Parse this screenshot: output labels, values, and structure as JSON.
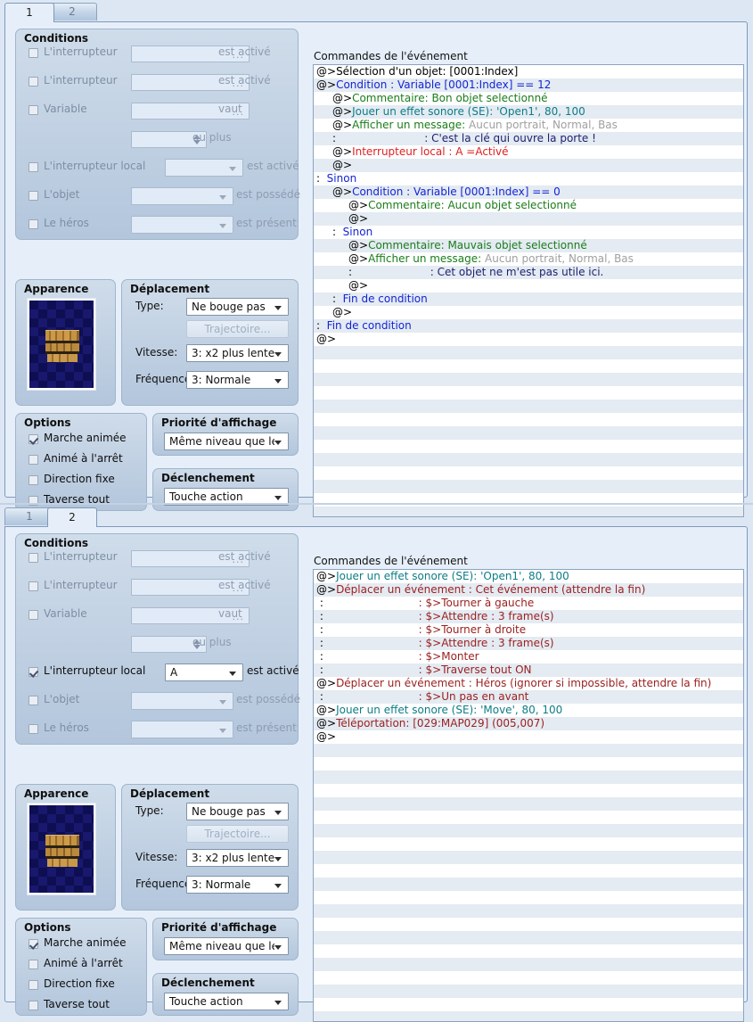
{
  "app": {
    "tabs": [
      "1",
      "2"
    ],
    "commands_header": "Commandes de l'événement"
  },
  "labels": {
    "conditions": "Conditions",
    "apparence": "Apparence",
    "deplacement": "Déplacement",
    "options": "Options",
    "priorite": "Priorité d'affichage",
    "declenchement": "Déclenchement",
    "type": "Type:",
    "vitesse": "Vitesse:",
    "frequence": "Fréquence:",
    "trajectoire": "Trajectoire...",
    "interrupteur": "L'interrupteur",
    "variable": "Variable",
    "interrupteur_local": "L'interrupteur local",
    "objet": "L'objet",
    "heros": "Le héros",
    "est_active": "est activé",
    "vaut": "vaut",
    "ou_plus": "ou plus",
    "est_possede": "est possédé",
    "est_present": "est présent",
    "marche_animee": "Marche animée",
    "anime_arret": "Animé à l'arrêt",
    "direction_fixe": "Direction fixe",
    "traverse_tout": "Taverse tout"
  },
  "values": {
    "type": "Ne bouge pas",
    "vitesse": "3: x2 plus lente",
    "frequence": "3: Normale",
    "priorite": "Même niveau que le h",
    "declenchement": "Touche action",
    "local_switch_p1": "",
    "local_switch_p2": "A",
    "switch1": "",
    "switch2": "",
    "variable": "",
    "variable_num": "",
    "objet": "",
    "heros": ""
  },
  "panel1": {
    "active_tab": "1",
    "checks": {
      "interrupteur1": false,
      "interrupteur2": false,
      "variable": false,
      "interrupteur_local": false,
      "objet": false,
      "heros": false,
      "marche_animee": true,
      "anime_arret": false,
      "direction_fixe": false,
      "traverse_tout": false
    },
    "commands": [
      {
        "indent": 0,
        "parts": [
          {
            "t": "@>",
            "c": "c-black"
          },
          {
            "t": "Sélection d'un objet: [0001:Index]",
            "c": "c-black"
          }
        ]
      },
      {
        "indent": 0,
        "parts": [
          {
            "t": "@>",
            "c": "c-black"
          },
          {
            "t": "Condition : Variable [0001:Index] == 12",
            "c": "c-blue"
          }
        ]
      },
      {
        "indent": 1,
        "parts": [
          {
            "t": "@>",
            "c": "c-black"
          },
          {
            "t": "Commentaire: Bon objet selectionné",
            "c": "c-green"
          }
        ]
      },
      {
        "indent": 1,
        "parts": [
          {
            "t": "@>",
            "c": "c-black"
          },
          {
            "t": "Jouer un effet sonore (SE): 'Open1', 80, 100",
            "c": "c-teal"
          }
        ]
      },
      {
        "indent": 1,
        "parts": [
          {
            "t": "@>",
            "c": "c-black"
          },
          {
            "t": "Afficher un message: ",
            "c": "c-darkgreen"
          },
          {
            "t": "Aucun portrait, Normal, Bas",
            "c": "c-gray"
          }
        ]
      },
      {
        "indent": 1,
        "parts": [
          {
            "t": ":",
            "c": "c-black"
          },
          {
            "t": "                          : C'est la clé qui ouvre la porte !",
            "c": "c-navy"
          }
        ]
      },
      {
        "indent": 1,
        "parts": [
          {
            "t": "@>",
            "c": "c-black"
          },
          {
            "t": "Interrupteur local : A =Activé",
            "c": "c-red"
          }
        ]
      },
      {
        "indent": 1,
        "parts": [
          {
            "t": "@>",
            "c": "c-black"
          }
        ]
      },
      {
        "indent": 0,
        "parts": [
          {
            "t": ":  ",
            "c": "c-black"
          },
          {
            "t": "Sinon",
            "c": "c-blue"
          }
        ]
      },
      {
        "indent": 1,
        "parts": [
          {
            "t": "@>",
            "c": "c-black"
          },
          {
            "t": "Condition : Variable [0001:Index] == 0",
            "c": "c-blue"
          }
        ]
      },
      {
        "indent": 2,
        "parts": [
          {
            "t": "@>",
            "c": "c-black"
          },
          {
            "t": "Commentaire: Aucun objet selectionné",
            "c": "c-green"
          }
        ]
      },
      {
        "indent": 2,
        "parts": [
          {
            "t": "@>",
            "c": "c-black"
          }
        ]
      },
      {
        "indent": 1,
        "parts": [
          {
            "t": ":  ",
            "c": "c-black"
          },
          {
            "t": "Sinon",
            "c": "c-blue"
          }
        ]
      },
      {
        "indent": 2,
        "parts": [
          {
            "t": "@>",
            "c": "c-black"
          },
          {
            "t": "Commentaire: Mauvais objet selectionné",
            "c": "c-green"
          }
        ]
      },
      {
        "indent": 2,
        "parts": [
          {
            "t": "@>",
            "c": "c-black"
          },
          {
            "t": "Afficher un message: ",
            "c": "c-darkgreen"
          },
          {
            "t": "Aucun portrait, Normal, Bas",
            "c": "c-gray"
          }
        ]
      },
      {
        "indent": 2,
        "parts": [
          {
            "t": ":",
            "c": "c-black"
          },
          {
            "t": "                       : Cet objet ne m'est pas utile ici.",
            "c": "c-navy"
          }
        ]
      },
      {
        "indent": 2,
        "parts": [
          {
            "t": "@>",
            "c": "c-black"
          }
        ]
      },
      {
        "indent": 1,
        "parts": [
          {
            "t": ":  ",
            "c": "c-black"
          },
          {
            "t": "Fin de condition",
            "c": "c-blue"
          }
        ]
      },
      {
        "indent": 1,
        "parts": [
          {
            "t": "@>",
            "c": "c-black"
          }
        ]
      },
      {
        "indent": 0,
        "parts": [
          {
            "t": ":  ",
            "c": "c-black"
          },
          {
            "t": "Fin de condition",
            "c": "c-blue"
          }
        ]
      },
      {
        "indent": 0,
        "parts": [
          {
            "t": "@>",
            "c": "c-black"
          }
        ]
      }
    ]
  },
  "panel2": {
    "active_tab": "2",
    "checks": {
      "interrupteur1": false,
      "interrupteur2": false,
      "variable": false,
      "interrupteur_local": true,
      "objet": false,
      "heros": false,
      "marche_animee": true,
      "anime_arret": false,
      "direction_fixe": false,
      "traverse_tout": false
    },
    "commands": [
      {
        "indent": 0,
        "parts": [
          {
            "t": "@>",
            "c": "c-black"
          },
          {
            "t": "Jouer un effet sonore (SE): 'Open1', 80, 100",
            "c": "c-teal"
          }
        ]
      },
      {
        "indent": 0,
        "parts": [
          {
            "t": "@>",
            "c": "c-black"
          },
          {
            "t": "Déplacer un événement : Cet événement (attendre la fin)",
            "c": "c-maroon"
          }
        ]
      },
      {
        "indent": 0,
        "parts": [
          {
            "t": " :",
            "c": "c-black"
          },
          {
            "t": "                            : $>Tourner à gauche",
            "c": "c-maroon"
          }
        ]
      },
      {
        "indent": 0,
        "parts": [
          {
            "t": " :",
            "c": "c-black"
          },
          {
            "t": "                            : $>Attendre : 3 frame(s)",
            "c": "c-maroon"
          }
        ]
      },
      {
        "indent": 0,
        "parts": [
          {
            "t": " :",
            "c": "c-black"
          },
          {
            "t": "                            : $>Tourner à droite",
            "c": "c-maroon"
          }
        ]
      },
      {
        "indent": 0,
        "parts": [
          {
            "t": " :",
            "c": "c-black"
          },
          {
            "t": "                            : $>Attendre : 3 frame(s)",
            "c": "c-maroon"
          }
        ]
      },
      {
        "indent": 0,
        "parts": [
          {
            "t": " :",
            "c": "c-black"
          },
          {
            "t": "                            : $>Monter",
            "c": "c-maroon"
          }
        ]
      },
      {
        "indent": 0,
        "parts": [
          {
            "t": " :",
            "c": "c-black"
          },
          {
            "t": "                            : $>Traverse tout ON",
            "c": "c-maroon"
          }
        ]
      },
      {
        "indent": 0,
        "parts": [
          {
            "t": "@>",
            "c": "c-black"
          },
          {
            "t": "Déplacer un événement : Héros (ignorer si impossible, attendre la fin)",
            "c": "c-maroon"
          }
        ]
      },
      {
        "indent": 0,
        "parts": [
          {
            "t": " :",
            "c": "c-black"
          },
          {
            "t": "                            : $>Un pas en avant",
            "c": "c-maroon"
          }
        ]
      },
      {
        "indent": 0,
        "parts": [
          {
            "t": "@>",
            "c": "c-black"
          },
          {
            "t": "Jouer un effet sonore (SE): 'Move', 80, 100",
            "c": "c-teal"
          }
        ]
      },
      {
        "indent": 0,
        "parts": [
          {
            "t": "@>",
            "c": "c-black"
          },
          {
            "t": "Téléportation: [029:MAP029] (005,007)",
            "c": "c-maroon"
          }
        ]
      },
      {
        "indent": 0,
        "parts": [
          {
            "t": "@>",
            "c": "c-black"
          }
        ]
      }
    ]
  },
  "colors": {
    "background": "#dde7f4",
    "group": "#b3c6dc",
    "border": "#8ba3bf",
    "list_alt": "#e4ebf2"
  }
}
